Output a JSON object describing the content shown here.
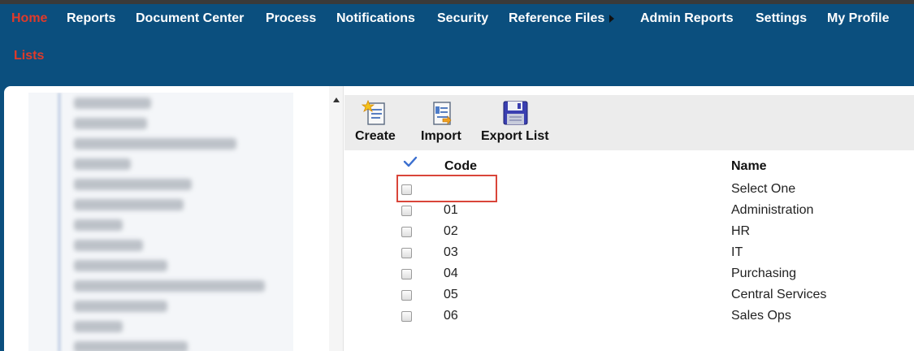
{
  "nav": {
    "row1": [
      "Home",
      "Reports",
      "Document Center",
      "Process",
      "Notifications",
      "Security",
      "Reference Files",
      "Admin Reports",
      "Settings",
      "My Profile"
    ],
    "row2": [
      "Lists"
    ],
    "active": "Home",
    "active_color": "#e03a2a"
  },
  "toolbar": {
    "create_label": "Create",
    "import_label": "Import",
    "export_label": "Export List"
  },
  "list": {
    "columns": {
      "code": "Code",
      "name": "Name"
    },
    "rows": [
      {
        "code": "",
        "name": "Select One"
      },
      {
        "code": "01",
        "name": "Administration"
      },
      {
        "code": "02",
        "name": "HR"
      },
      {
        "code": "03",
        "name": "IT"
      },
      {
        "code": "04",
        "name": "Purchasing"
      },
      {
        "code": "05",
        "name": "Central Services"
      },
      {
        "code": "06",
        "name": "Sales Ops"
      }
    ]
  },
  "colors": {
    "header_bg": "#0b4f7e",
    "highlight": "#d9453a"
  }
}
